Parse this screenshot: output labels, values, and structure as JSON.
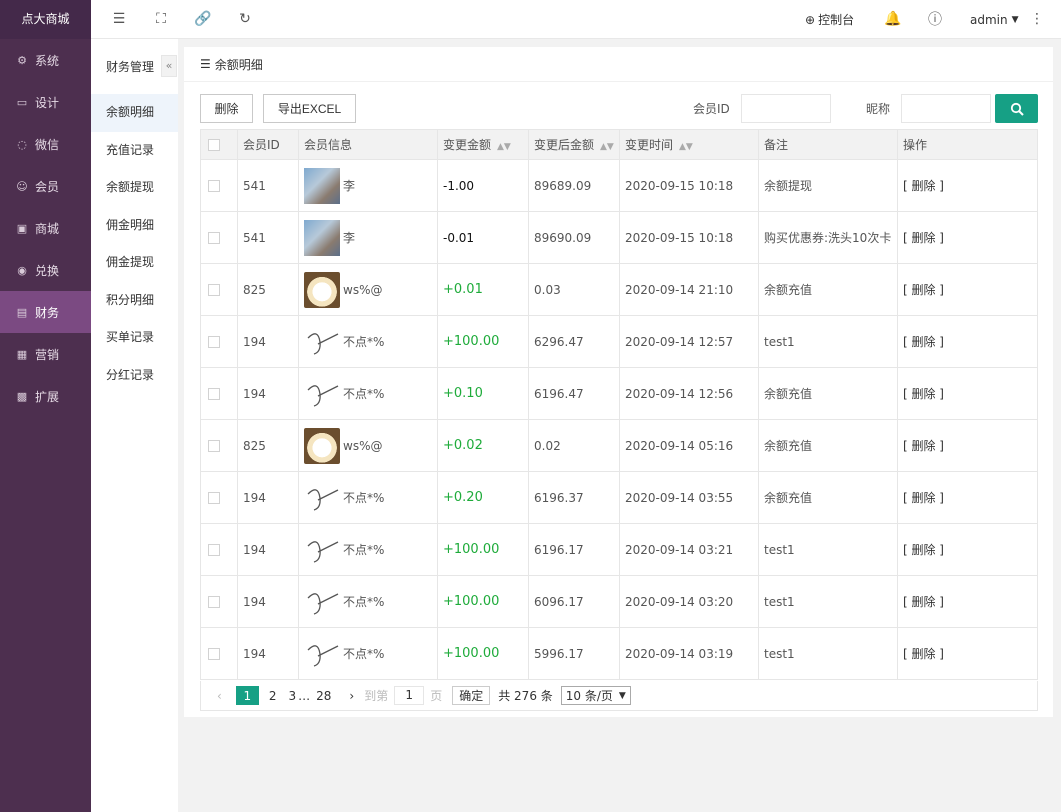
{
  "brand": "点大商城",
  "sidebar": {
    "items": [
      {
        "label": "系统",
        "icon": "gear-icon",
        "glyph": "⚙"
      },
      {
        "label": "设计",
        "icon": "monitor-icon",
        "glyph": "▭"
      },
      {
        "label": "微信",
        "icon": "wechat-icon",
        "glyph": "◌"
      },
      {
        "label": "会员",
        "icon": "user-icon",
        "glyph": "☺"
      },
      {
        "label": "商城",
        "icon": "shop-icon",
        "glyph": "▣"
      },
      {
        "label": "兑换",
        "icon": "exchange-icon",
        "glyph": "◉"
      },
      {
        "label": "财务",
        "icon": "finance-icon",
        "glyph": "▤"
      },
      {
        "label": "营销",
        "icon": "gift-icon",
        "glyph": "▦"
      },
      {
        "label": "扩展",
        "icon": "grid-icon",
        "glyph": "▩"
      }
    ],
    "active_index": 6
  },
  "topbar": {
    "console_label": "控制台",
    "user": "admin"
  },
  "subnav": {
    "title": "财务管理",
    "collapse": "«",
    "items": [
      "余额明细",
      "充值记录",
      "余额提现",
      "佣金明细",
      "佣金提现",
      "积分明细",
      "买单记录",
      "分红记录"
    ],
    "active_index": 0
  },
  "card": {
    "title": "余额明细",
    "delete_button": "删除",
    "export_button": "导出EXCEL",
    "member_id_label": "会员ID",
    "nickname_label": "昵称"
  },
  "table": {
    "columns": [
      "会员ID",
      "会员信息",
      "变更金额",
      "变更后金额",
      "变更时间",
      "备注",
      "操作"
    ],
    "rows": [
      {
        "id": "541",
        "name": "李",
        "avatar": "photo",
        "amount": "-1.00",
        "after": "89689.09",
        "time": "2020-09-15 10:18",
        "remark": "余额提现",
        "action": "[ 删除 ]"
      },
      {
        "id": "541",
        "name": "李",
        "avatar": "photo",
        "amount": "-0.01",
        "after": "89690.09",
        "time": "2020-09-15 10:18",
        "remark": "购买优惠券:洗头10次卡",
        "action": "[ 删除 ]"
      },
      {
        "id": "825",
        "name": "ws%@",
        "avatar": "cat",
        "amount": "+0.01",
        "after": "0.03",
        "time": "2020-09-14 21:10",
        "remark": "余额充值",
        "action": "[ 删除 ]"
      },
      {
        "id": "194",
        "name": "不点*%",
        "avatar": "sign",
        "amount": "+100.00",
        "after": "6296.47",
        "time": "2020-09-14 12:57",
        "remark": "test1",
        "action": "[ 删除 ]"
      },
      {
        "id": "194",
        "name": "不点*%",
        "avatar": "sign",
        "amount": "+0.10",
        "after": "6196.47",
        "time": "2020-09-14 12:56",
        "remark": "余额充值",
        "action": "[ 删除 ]"
      },
      {
        "id": "825",
        "name": "ws%@",
        "avatar": "cat",
        "amount": "+0.02",
        "after": "0.02",
        "time": "2020-09-14 05:16",
        "remark": "余额充值",
        "action": "[ 删除 ]"
      },
      {
        "id": "194",
        "name": "不点*%",
        "avatar": "sign",
        "amount": "+0.20",
        "after": "6196.37",
        "time": "2020-09-14 03:55",
        "remark": "余额充值",
        "action": "[ 删除 ]"
      },
      {
        "id": "194",
        "name": "不点*%",
        "avatar": "sign",
        "amount": "+100.00",
        "after": "6196.17",
        "time": "2020-09-14 03:21",
        "remark": "test1",
        "action": "[ 删除 ]"
      },
      {
        "id": "194",
        "name": "不点*%",
        "avatar": "sign",
        "amount": "+100.00",
        "after": "6096.17",
        "time": "2020-09-14 03:20",
        "remark": "test1",
        "action": "[ 删除 ]"
      },
      {
        "id": "194",
        "name": "不点*%",
        "avatar": "sign",
        "amount": "+100.00",
        "after": "5996.17",
        "time": "2020-09-14 03:19",
        "remark": "test1",
        "action": "[ 删除 ]"
      }
    ]
  },
  "pager": {
    "prev": "‹",
    "current": "1",
    "pages": [
      "2",
      "3"
    ],
    "ellipsis": "…",
    "last": "28",
    "next": "›",
    "goto_label": "到第",
    "goto_value": "1",
    "page_unit": "页",
    "confirm": "确定",
    "total": "共 276 条",
    "page_size": "10 条/页"
  },
  "colors": {
    "sidebar_bg": "#4d2f4f",
    "sidebar_active": "#7b4a82",
    "accent": "#16a085",
    "positive_amount": "#1eab3a"
  }
}
